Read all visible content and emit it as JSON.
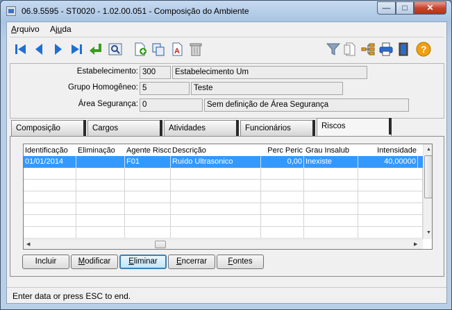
{
  "window": {
    "title": "06.9.5595 - ST0020 - 1.02.00.051 - Composição do Ambiente",
    "min": "—",
    "max": "□",
    "close": "✕"
  },
  "menu": {
    "arquivo_u": "A",
    "arquivo_rest": "rquivo",
    "ajuda_pre": "Aj",
    "ajuda_u": "u",
    "ajuda_rest": "da"
  },
  "toolbar": {
    "icons": [
      "first-record-icon",
      "previous-record-icon",
      "next-record-icon",
      "last-record-icon",
      "return-icon",
      "search-icon",
      "new-document-icon",
      "copy-icon",
      "edit-text-icon",
      "delete-icon",
      "filter-icon",
      "documents-icon",
      "tree-icon",
      "print-icon",
      "exit-icon",
      "help-icon"
    ]
  },
  "fields": {
    "estabelecimento": {
      "label": "Estabelecimento:",
      "code": "300",
      "desc": "Estabelecimento Um"
    },
    "grupo": {
      "label": "Grupo Homogêneo:",
      "code": "5",
      "desc": "Teste"
    },
    "area": {
      "label": "Área Segurança:",
      "code": "0",
      "desc": "Sem definição de Área Segurança"
    }
  },
  "tabs": [
    "Composição",
    "Cargos",
    "Atividades",
    "Funcionários",
    "Riscos"
  ],
  "active_tab": "Riscos",
  "grid": {
    "columns": [
      "Identificação",
      "Eliminação",
      "Agente Risco",
      "Descrição",
      "Perc Peric",
      "Grau Insalub",
      "Intensidade"
    ],
    "rows": [
      {
        "identificacao": "01/01/2014",
        "eliminacao": "",
        "agente": "F01",
        "descricao": "Ruído Ultrasonico",
        "perc": "0,00",
        "grau": "Inexiste",
        "intensidade": "40,00000"
      }
    ]
  },
  "buttons": {
    "incluir": "Incluir",
    "modificar_u": "M",
    "modificar_rest": "odificar",
    "eliminar_u": "E",
    "eliminar_rest": "liminar",
    "encerrar_u": "E",
    "encerrar_rest": "ncerrar",
    "fontes_u": "F",
    "fontes_rest": "ontes"
  },
  "status": "Enter data or press ESC to end.",
  "colors": {
    "selection": "#3399ff",
    "titlebar": "#b9cfe8",
    "close": "#c8452d"
  }
}
